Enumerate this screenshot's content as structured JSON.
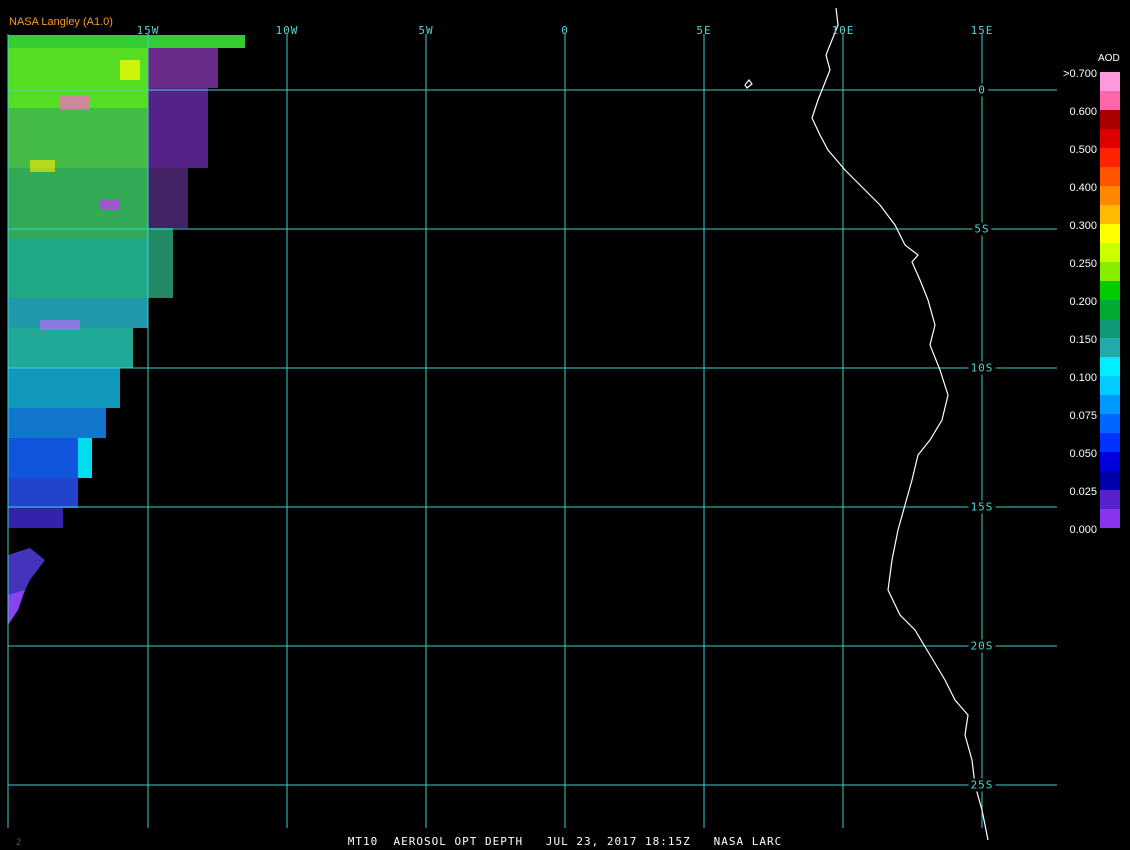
{
  "header": {
    "credit": "NASA Langley (A1.0)"
  },
  "map": {
    "lon_labels": [
      "15W",
      "10W",
      "5W",
      "0",
      "5E",
      "10E",
      "15E"
    ],
    "lat_labels": [
      "0",
      "5S",
      "10S",
      "15S",
      "20S",
      "25S"
    ],
    "gridline_color": "#3fd0d0",
    "coastline_color": "#ffffff"
  },
  "legend": {
    "title": "AOD",
    "ticks": [
      ">0.700",
      "0.600",
      "0.500",
      "0.400",
      "0.300",
      "0.250",
      "0.200",
      "0.150",
      "0.100",
      "0.075",
      "0.050",
      "0.025",
      "0.000"
    ],
    "colors": [
      "#ff99dd",
      "#ff66aa",
      "#aa0000",
      "#dd0000",
      "#ff2200",
      "#ff5500",
      "#ff8800",
      "#ffbb00",
      "#ffff00",
      "#ccff00",
      "#88ee00",
      "#00cc00",
      "#00aa33",
      "#119977",
      "#22aaaa",
      "#00eeff",
      "#00ccff",
      "#0099ff",
      "#0066ff",
      "#0033ff",
      "#0000dd",
      "#0000aa",
      "#5522cc",
      "#8833ee"
    ]
  },
  "footer": {
    "text": "MT10  AEROSOL OPT DEPTH   JUL 23, 2017 18:15Z   NASA LARC",
    "corner": "2"
  }
}
